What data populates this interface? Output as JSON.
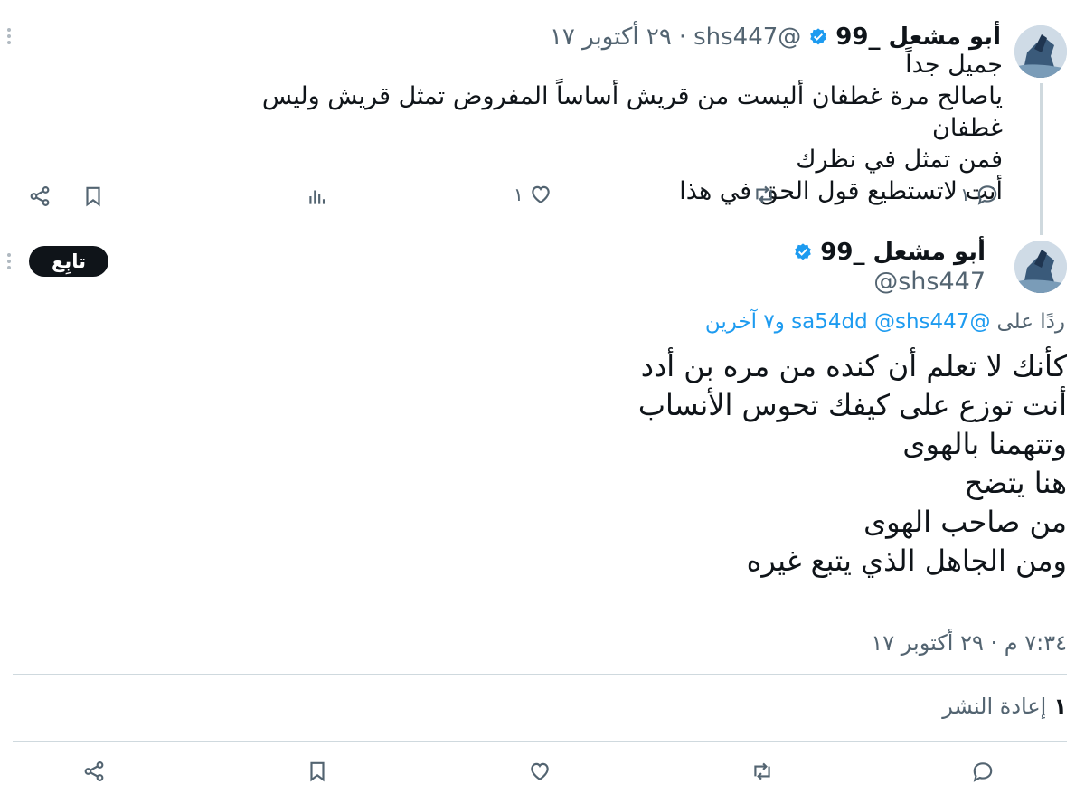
{
  "reply_tweet": {
    "display_name": "أبو مشعل _99",
    "handle": "@shs447",
    "separator": "·",
    "date": "٢٩ أكتوبر ١٧",
    "lines": [
      "جميل جداً",
      "ياصالح مرة غطفان أليست من قريش أساساً المفروض تمثل قريش وليس غطفان",
      "فمن تمثل في نظرك",
      "أنت لاتستطيع قول الحق في هذا"
    ],
    "reply_count": "١",
    "like_count": "١"
  },
  "main_tweet": {
    "display_name": "أبو مشعل _99",
    "handle": "@shs447",
    "follow_label": "تابِع",
    "replying_prefix": "ردًا على",
    "replying_to": "@sa54dd @shs447 و٧ آخرين",
    "lines": [
      "كأنك لا تعلم أن كنده من مره بن أدد",
      "أنت توزع على كيفك تحوس الأنساب",
      "وتتهمنا بالهوى",
      "هنا يتضح",
      "من صاحب الهوى",
      "ومن الجاهل الذي يتبع غيره"
    ],
    "timestamp": "٧:٣٤ م · ٢٩ أكتوبر ١٧",
    "retweet_count": "١",
    "retweet_label": "إعادة النشر"
  },
  "icons": {
    "verified": "verified-badge-icon",
    "reply": "reply-icon",
    "retweet": "retweet-icon",
    "like": "like-icon",
    "views": "views-icon",
    "bookmark": "bookmark-icon",
    "share": "share-icon",
    "more": "more-icon"
  },
  "colors": {
    "text": "#0f1419",
    "secondary": "#536471",
    "link": "#1d9bf0",
    "divider": "#cfd9de",
    "follow_bg": "#0f1419"
  }
}
